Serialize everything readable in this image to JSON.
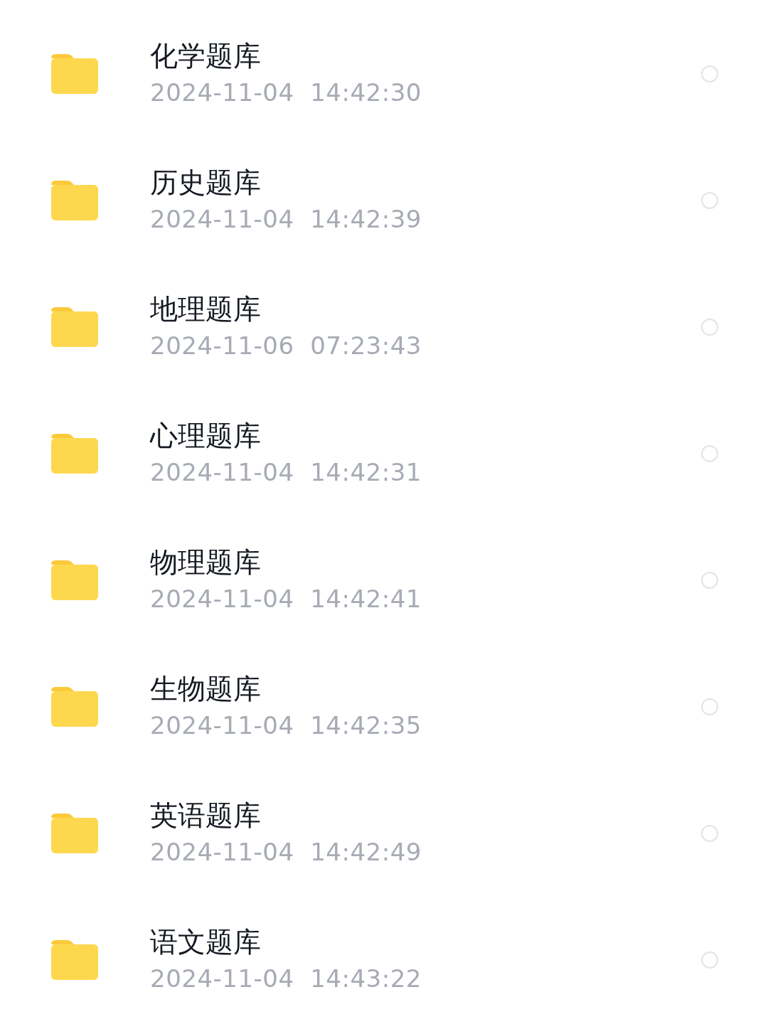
{
  "files": [
    {
      "name": "化学题库",
      "modified": "2024-11-04  14:42:30",
      "selected": false
    },
    {
      "name": "历史题库",
      "modified": "2024-11-04  14:42:39",
      "selected": false
    },
    {
      "name": "地理题库",
      "modified": "2024-11-06  07:23:43",
      "selected": false
    },
    {
      "name": "心理题库",
      "modified": "2024-11-04  14:42:31",
      "selected": false
    },
    {
      "name": "物理题库",
      "modified": "2024-11-04  14:42:41",
      "selected": false
    },
    {
      "name": "生物题库",
      "modified": "2024-11-04  14:42:35",
      "selected": false
    },
    {
      "name": "英语题库",
      "modified": "2024-11-04  14:42:49",
      "selected": false
    },
    {
      "name": "语文题库",
      "modified": "2024-11-04  14:43:22",
      "selected": false
    }
  ]
}
